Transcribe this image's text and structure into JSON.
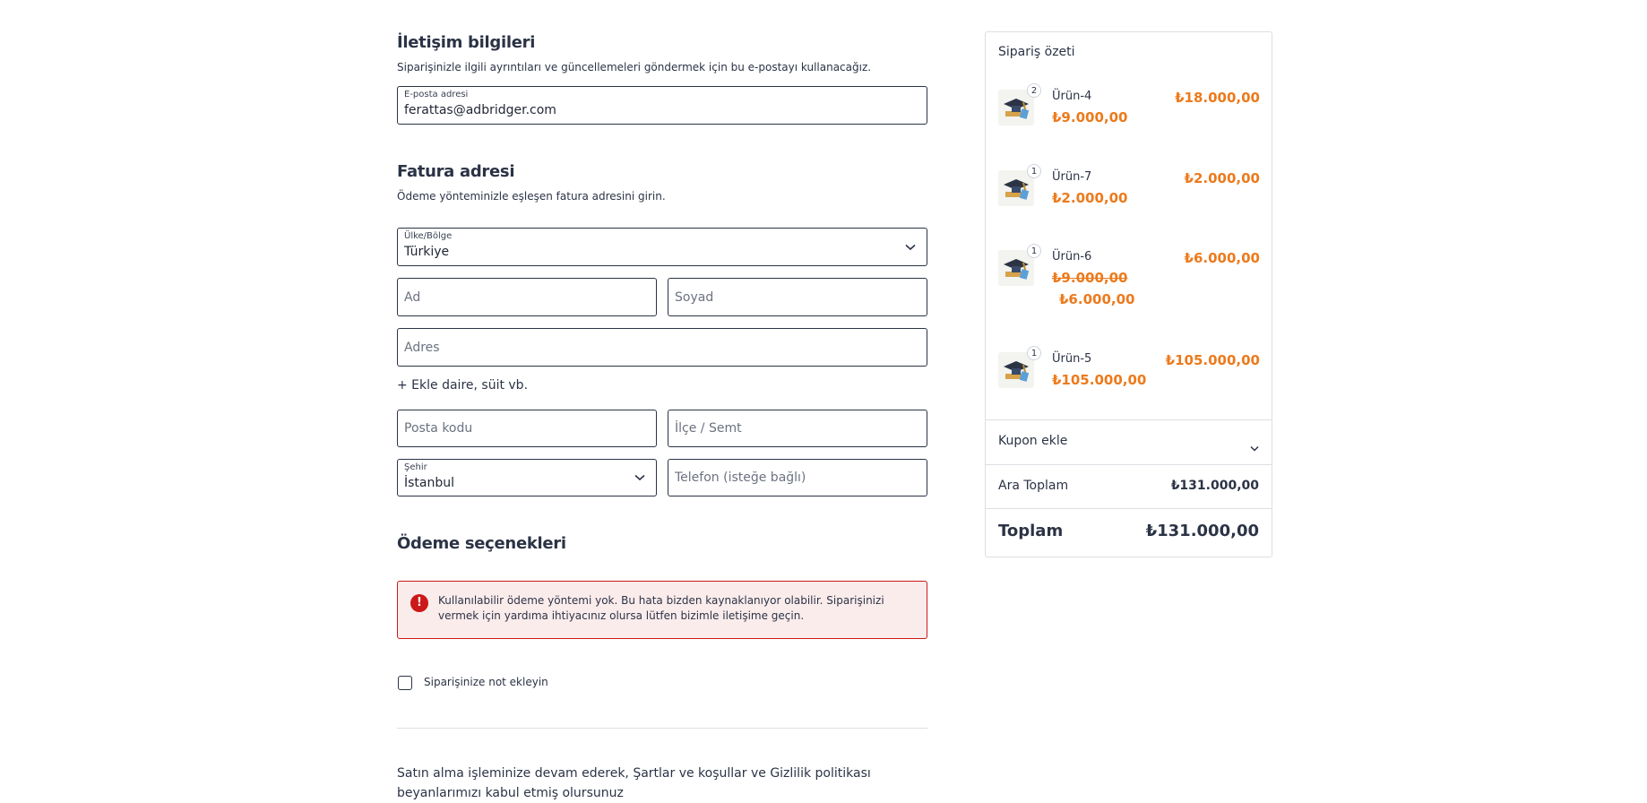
{
  "contact": {
    "title": "İletişim bilgileri",
    "subtitle": "Siparişinizle ilgili ayrıntıları ve güncellemeleri göndermek için bu e-postayı kullanacağız.",
    "email_label": "E-posta adresi",
    "email_value": "ferattas@adbridger.com"
  },
  "billing": {
    "title": "Fatura adresi",
    "subtitle": "Ödeme yönteminizle eşleşen fatura adresini girin.",
    "country_label": "Ülke/Bölge",
    "country_value": "Türkiye",
    "first_name_placeholder": "Ad",
    "last_name_placeholder": "Soyad",
    "address_placeholder": "Adres",
    "add_apartment_link": "+ Ekle daire, süit vb.",
    "postcode_placeholder": "Posta kodu",
    "district_placeholder": "İlçe / Semt",
    "city_label": "Şehir",
    "city_value": "İstanbul",
    "phone_placeholder": "Telefon (isteğe bağlı)"
  },
  "payment": {
    "title": "Ödeme seçenekleri",
    "error_icon": "!",
    "error_text": "Kullanılabilir ödeme yöntemi yok. Bu hata bizden kaynaklanıyor olabilir. Siparişinizi vermek için yardıma ihtiyacınız olursa lütfen bizimle iletişime geçin."
  },
  "note": {
    "label": "Siparişinize not ekleyin"
  },
  "terms": {
    "text": "Satın alma işleminize devam ederek, Şartlar ve koşullar ve Gizlilik politikası beyanlarımızı kabul etmiş olursunuz"
  },
  "summary": {
    "title": "Sipariş özeti",
    "items": [
      {
        "name": "Ürün-4",
        "qty": "2",
        "price": "₺9.000,00",
        "total": "₺18.000,00"
      },
      {
        "name": "Ürün-7",
        "qty": "1",
        "price": "₺2.000,00",
        "total": "₺2.000,00"
      },
      {
        "name": "Ürün-6",
        "qty": "1",
        "old_price": "₺9.000,00",
        "price": "₺6.000,00",
        "total": "₺6.000,00"
      },
      {
        "name": "Ürün-5",
        "qty": "1",
        "price": "₺105.000,00",
        "total": "₺105.000,00"
      }
    ],
    "coupon_label": "Kupon ekle",
    "subtotal_label": "Ara Toplam",
    "subtotal_value": "₺131.000,00",
    "total_label": "Toplam",
    "total_value": "₺131.000,00"
  },
  "colors": {
    "accent": "#ec7a1c",
    "error": "#cc1818",
    "text": "#2b3345"
  }
}
